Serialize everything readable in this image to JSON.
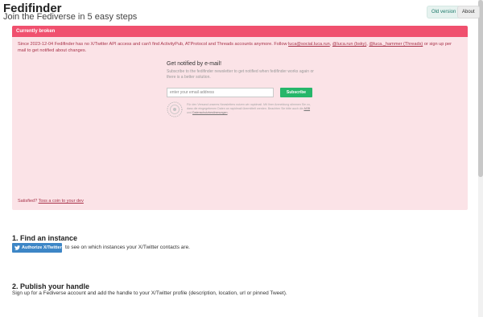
{
  "header": {
    "title": "Fedifinder",
    "subtitle": "Join the Fediverse in 5 easy steps",
    "old_version_label": "Old version",
    "about_label": "About"
  },
  "alert": {
    "header_label": "Currently broken",
    "message_start": "Since 2023-12-04 Fedifinder has no X/Twitter API access and can't find ActivityPub, ATProtocol and Threads accounts anymore. Follow ",
    "links": [
      "luca@social.luca.run",
      "@luca.run (bsky)",
      "@luca._hammer (Threads)"
    ],
    "sep1": ", ",
    "sep2": ", ",
    "message_end": " or sign up per mail to get notified about changes.",
    "notify": {
      "title": "Get notified by e-mail!",
      "description": "Subscribe to the fedifinder newsletter to get notified when fedifinder works again or there is a better solution.",
      "email_placeholder": "enter your email address",
      "subscribe_label": "Subscribe",
      "privacy_text": "Für den Versand unseres Newsletters nutzen wir rapidmail. Mit Ihrer Anmeldung stimmen Sie zu, dass die eingegebenen Daten an rapidmail übermittelt werden. Beachten Sie bitte auch die ",
      "agb_link": "AGB",
      "privacy_and": " und ",
      "datenschutz_link": "Datenschutzbestimmungen",
      "privacy_end": "."
    },
    "satisfied_prefix": "Satisfied? ",
    "satisfied_link": "Toss a coin to your dev"
  },
  "steps": [
    {
      "heading": "1. Find an instance",
      "button_label": "Authorize X/Twitter",
      "text": "to see on which instances your X/Twitter contacts are."
    },
    {
      "heading": "2. Publish your handle",
      "text": "Sign up for a Fediverse account and add the handle to your X/Twitter profile (description, location, url or pinned Tweet)."
    }
  ],
  "colors": {
    "alert_header": "#f0506e",
    "alert_bg": "#fbe3e7",
    "alert_text": "#a8334a",
    "subscribe_green": "#26b66a",
    "twitter_blue": "#3d86c6"
  },
  "icons": {
    "subscribe_badge": "rapidmail-badge-icon",
    "authorize": "twitter-bird-icon"
  }
}
